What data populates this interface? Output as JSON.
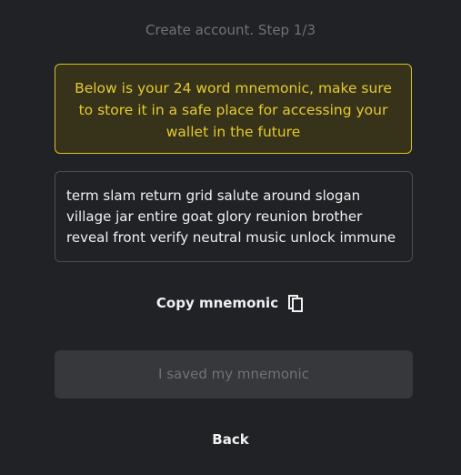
{
  "header": {
    "step_title": "Create account. Step 1/3"
  },
  "warning": {
    "text": "Below is your 24 word mnemonic, make sure to store it in a safe place for accessing your wallet in the future"
  },
  "mnemonic": {
    "text": "term slam return grid salute around slogan village jar entire goat glory reunion brother reveal front verify neutral music unlock immune"
  },
  "actions": {
    "copy_label": "Copy mnemonic",
    "copy_icon": "copy-icon",
    "saved_label": "I saved my mnemonic",
    "saved_enabled": false,
    "back_label": "Back"
  },
  "colors": {
    "background": "#202225",
    "warning_border": "#d9c11c",
    "warning_text": "#e6ca2a",
    "warning_background": "#36331a",
    "disabled_button": "#36383c",
    "muted_text": "#6f7276",
    "text": "#f1f1f1"
  }
}
